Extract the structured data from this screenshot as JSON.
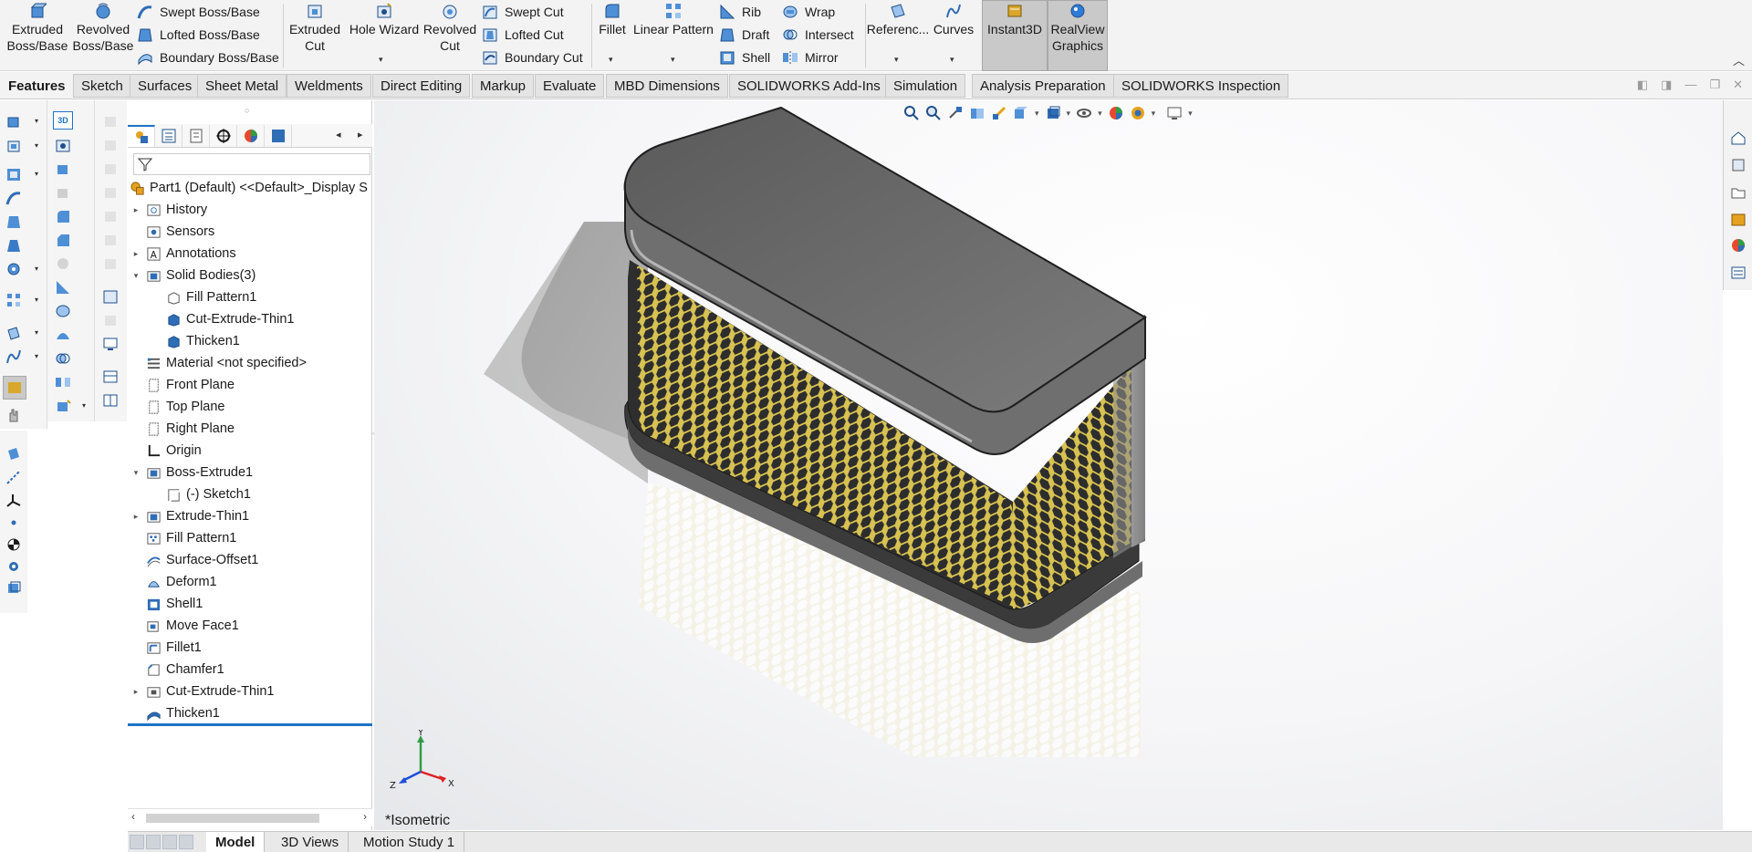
{
  "ribbon": {
    "extruded_boss": "Extruded\nBoss/Base",
    "revolved_boss": "Revolved\nBoss/Base",
    "swept_boss": "Swept Boss/Base",
    "lofted_boss": "Lofted Boss/Base",
    "boundary_boss": "Boundary Boss/Base",
    "extruded_cut": "Extruded\nCut",
    "hole_wizard": "Hole Wizard",
    "revolved_cut": "Revolved\nCut",
    "swept_cut": "Swept Cut",
    "lofted_cut": "Lofted Cut",
    "boundary_cut": "Boundary Cut",
    "fillet": "Fillet",
    "linear_pattern": "Linear Pattern",
    "rib": "Rib",
    "draft": "Draft",
    "shell": "Shell",
    "wrap": "Wrap",
    "intersect": "Intersect",
    "mirror": "Mirror",
    "reference": "Referenc...",
    "curves": "Curves",
    "instant3d": "Instant3D",
    "realview": "RealView\nGraphics"
  },
  "command_tabs": [
    "Features",
    "Sketch",
    "Surfaces",
    "Sheet Metal",
    "Weldments",
    "Direct Editing",
    "Markup",
    "Evaluate",
    "MBD Dimensions",
    "SOLIDWORKS Add-Ins",
    "Simulation",
    "Analysis Preparation",
    "SOLIDWORKS Inspection"
  ],
  "active_command_tab": "Features",
  "feature_tree": {
    "root": "Part1 (Default) <<Default>_Display S",
    "items": [
      {
        "label": "History",
        "expandable": true,
        "level": 0
      },
      {
        "label": "Sensors",
        "expandable": false,
        "level": 0
      },
      {
        "label": "Annotations",
        "expandable": true,
        "level": 0
      },
      {
        "label": "Solid Bodies(3)",
        "expandable": true,
        "expanded": true,
        "level": 0
      },
      {
        "label": "Fill Pattern1",
        "expandable": false,
        "level": 1
      },
      {
        "label": "Cut-Extrude-Thin1",
        "expandable": false,
        "level": 1
      },
      {
        "label": "Thicken1",
        "expandable": false,
        "level": 1
      },
      {
        "label": "Material <not specified>",
        "expandable": false,
        "level": 0
      },
      {
        "label": "Front Plane",
        "expandable": false,
        "level": 0
      },
      {
        "label": "Top Plane",
        "expandable": false,
        "level": 0
      },
      {
        "label": "Right Plane",
        "expandable": false,
        "level": 0
      },
      {
        "label": "Origin",
        "expandable": false,
        "level": 0
      },
      {
        "label": "Boss-Extrude1",
        "expandable": true,
        "expanded": true,
        "level": 0
      },
      {
        "label": "(-) Sketch1",
        "expandable": false,
        "level": 1
      },
      {
        "label": "Extrude-Thin1",
        "expandable": true,
        "level": 0
      },
      {
        "label": "Fill Pattern1",
        "expandable": false,
        "level": 0
      },
      {
        "label": "Surface-Offset1",
        "expandable": false,
        "level": 0
      },
      {
        "label": "Deform1",
        "expandable": false,
        "level": 0
      },
      {
        "label": "Shell1",
        "expandable": false,
        "level": 0
      },
      {
        "label": "Move Face1",
        "expandable": false,
        "level": 0
      },
      {
        "label": "Fillet1",
        "expandable": false,
        "level": 0
      },
      {
        "label": "Chamfer1",
        "expandable": false,
        "level": 0
      },
      {
        "label": "Cut-Extrude-Thin1",
        "expandable": true,
        "level": 0
      },
      {
        "label": "Thicken1",
        "expandable": false,
        "level": 0
      }
    ]
  },
  "viewport": {
    "view_name": "*Isometric",
    "triad": {
      "x": "X",
      "y": "Y",
      "z": "Z"
    }
  },
  "bottom_tabs": [
    "Model",
    "3D Views",
    "Motion Study 1"
  ],
  "active_bottom_tab": "Model",
  "colors": {
    "accent": "#1e72c8",
    "ribbon_bg": "#f3f3f3",
    "mesh_yellow": "#d9c65a",
    "body_gray": "#6b6b6b"
  }
}
